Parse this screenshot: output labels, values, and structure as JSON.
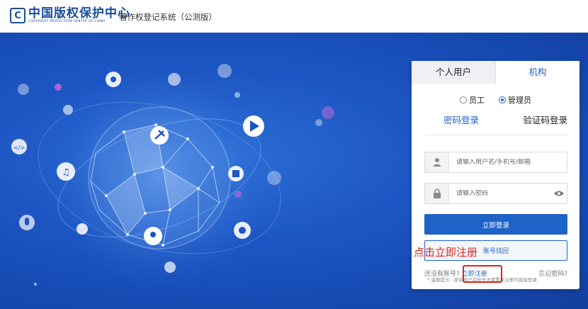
{
  "header": {
    "logo_mark": "C",
    "logo_main": "中国版权保护中心",
    "logo_sub": "COPYRIGHT PROTECTION CENTER OF CHINA",
    "system_title": "著作权登记系统（公测版）"
  },
  "login": {
    "tabs": [
      "个人用户",
      "机构"
    ],
    "active_tab": "机构",
    "roles": [
      "员工",
      "管理员"
    ],
    "selected_role": "管理员",
    "modes": [
      "密码登录",
      "验证码登录"
    ],
    "active_mode": "密码登录",
    "username_placeholder": "请输入用户名/手机号/邮箱",
    "password_placeholder": "请输入密码",
    "login_button": "立即登录",
    "recover_button": "账号找回",
    "no_account_text": "还没有账号?",
    "register_link": "立即注册",
    "forgot_link": "忘记密码?",
    "hint": "* 温馨提示：原系统已有账号无需重新注册可直接登录"
  },
  "annotation": {
    "text": "点击立即注册",
    "color": "#d9251c"
  },
  "colors": {
    "brand_blue": "#1a4f9c",
    "primary": "#1f63c9",
    "hero_background": "#1d56c4"
  }
}
